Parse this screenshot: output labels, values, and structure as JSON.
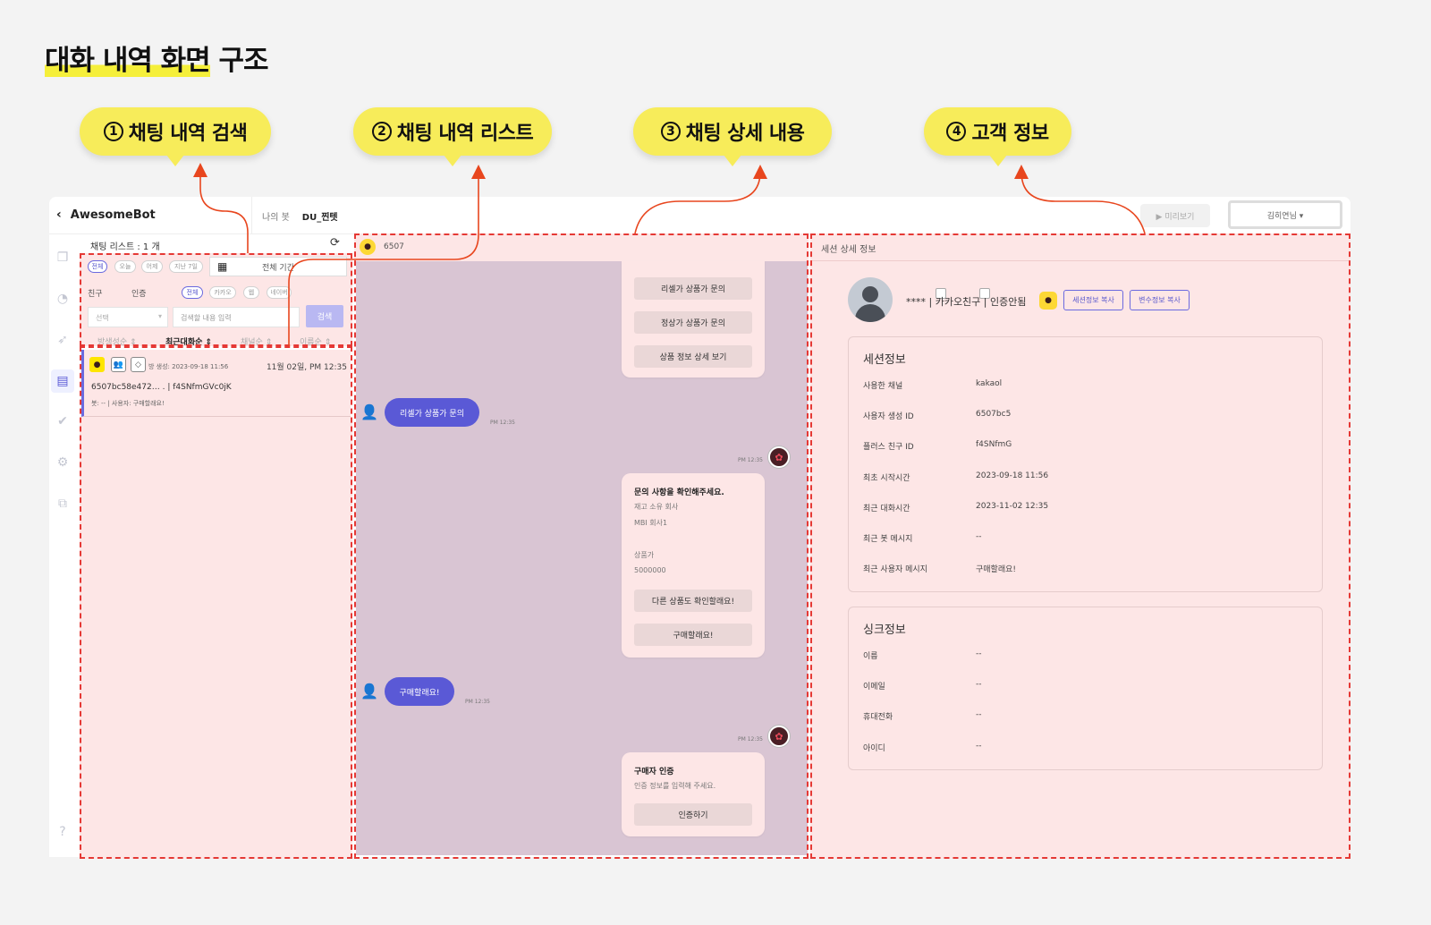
{
  "page": {
    "title_highlight": "대화 내역 화면",
    "title_rest": " 구조"
  },
  "callouts": [
    {
      "num": "1",
      "label": "채팅 내역 검색"
    },
    {
      "num": "2",
      "label": "채팅 내역 리스트"
    },
    {
      "num": "3",
      "label": "채팅 상세 내용"
    },
    {
      "num": "4",
      "label": "고객 정보"
    }
  ],
  "topbar": {
    "brand": "AwesomeBot",
    "back_icon": "chevron-left-icon",
    "crumb_label": "나의 봇",
    "bot_name": "DU_찐텟",
    "preview_label": "▶ 미리보기",
    "user_label": "김히연님 ▾"
  },
  "nav_icons": [
    "copy-icon",
    "pie-chart-icon",
    "rocket-icon",
    "chat-icon",
    "check-circle-icon",
    "gear-icon",
    "share-icon",
    "help-icon"
  ],
  "search": {
    "list_count": "채팅 리스트 : 1 개",
    "period_chips": [
      "전체",
      "오늘",
      "어제",
      "지난 7일"
    ],
    "date_range": "전체 기간",
    "checkbox_friend": "친구",
    "checkbox_auth": "인증",
    "channel_chips": [
      "전체",
      "카카오",
      "웹",
      "네이버"
    ],
    "select_placeholder": "선택",
    "input_placeholder": "검색할 내용 입력",
    "search_button": "검색"
  },
  "sort": [
    "방생성순 ⇕",
    "최근대화순 ⇕",
    "채널순 ⇕",
    "이름순 ⇕"
  ],
  "list": [
    {
      "created": "방 생성: 2023-09-18 11:56",
      "date": "11월 02일, PM 12:35",
      "id": "6507bc58e472…                 . | f4SNfmGVc0jK",
      "preview": "봇: -- | 사용자: 구매할래요!"
    }
  ],
  "chat": {
    "header_id": "6507",
    "card1_buttons": [
      "리셀가 상품가 문의",
      "정상가 상품가 문의",
      "상품 정보 상세 보기"
    ],
    "user_msg1": "리셀가 상품가 문의",
    "time": "PM 12:35",
    "card2_title": "문의 사항을 확인해주세요.",
    "card2_lines": [
      "재고 소유 회사",
      "MBI 회사1",
      "상품가",
      "5000000"
    ],
    "card2_buttons": [
      "다른 상품도 확인할래요!",
      "구매할래요!"
    ],
    "user_msg2": "구매할래요!",
    "card3_title": "구매자 인증",
    "card3_text": "인증 정보를 입력해 주세요.",
    "card3_button": "인증하기"
  },
  "info": {
    "header": "세션 상세 정보",
    "customer": "**** | 카카오친구 | 인증안됨",
    "copy_session": "세션정보 복사",
    "copy_vars": "변수정보 복사",
    "session_title": "세션정보",
    "session": [
      {
        "k": "사용한 채널",
        "v": "kakaol"
      },
      {
        "k": "사용자 생성 ID",
        "v": "6507bc5"
      },
      {
        "k": "플러스 친구 ID",
        "v": "f4SNfmG"
      },
      {
        "k": "최초 시작시간",
        "v": "2023-09-18 11:56"
      },
      {
        "k": "최근 대화시간",
        "v": "2023-11-02 12:35"
      },
      {
        "k": "최근 봇 메시지",
        "v": "--"
      },
      {
        "k": "최근 사용자 메시지",
        "v": "구매할래요!"
      }
    ],
    "sync_title": "싱크정보",
    "sync": [
      {
        "k": "이름",
        "v": "--"
      },
      {
        "k": "이메일",
        "v": "--"
      },
      {
        "k": "휴대전화",
        "v": "--"
      },
      {
        "k": "아이디",
        "v": "--"
      }
    ]
  },
  "colors": {
    "highlight": "#f5ef3a",
    "callout": "#f7ec5a",
    "accent": "#5a59d6",
    "dash": "#e53935",
    "panel": "#fde6e6",
    "chat_bg": "#d9c5d3"
  }
}
